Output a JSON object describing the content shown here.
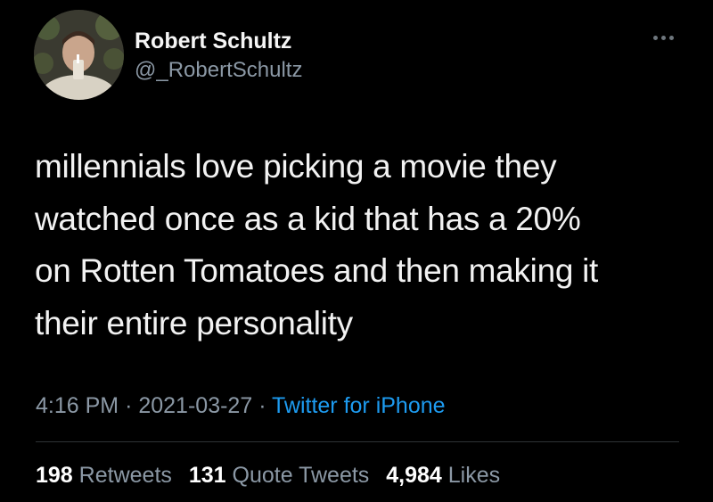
{
  "author": {
    "name": "Robert Schultz",
    "handle": "@_RobertSchultz"
  },
  "tweet": {
    "lines": [
      "millennials love picking a movie they",
      "watched once as a kid that has a 20%",
      "on Rotten Tomatoes and then making it",
      "their entire personality"
    ]
  },
  "meta": {
    "time": "4:16 PM",
    "separator": "·",
    "date": "2021-03-27",
    "source": "Twitter for iPhone"
  },
  "stats": {
    "retweets": {
      "count": "198",
      "label": "Retweets"
    },
    "quotes": {
      "count": "131",
      "label": "Quote Tweets"
    },
    "likes": {
      "count": "4,984",
      "label": "Likes"
    }
  },
  "icons": {
    "more": "more-horizontal-icon"
  },
  "colors": {
    "background": "#000000",
    "text": "#f2f2f2",
    "secondary": "#8b98a5",
    "link": "#1d9bf0",
    "divider": "#2f3336"
  }
}
